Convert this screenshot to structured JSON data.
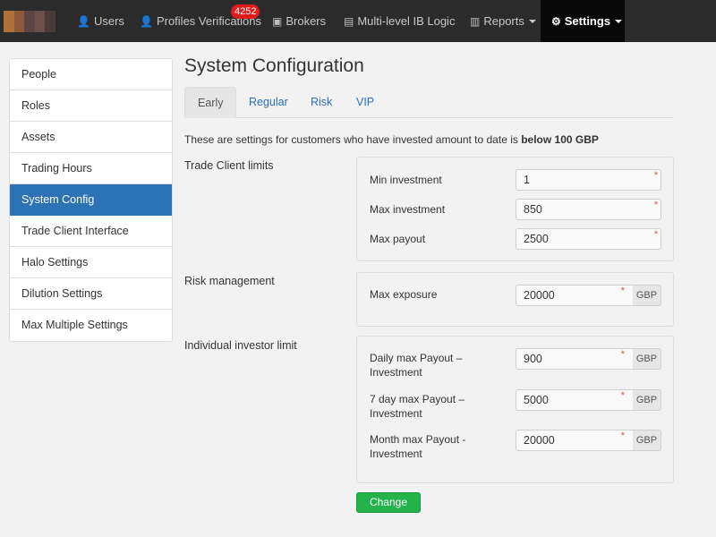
{
  "nav": {
    "items": [
      {
        "label": "Users",
        "icon": "user-icon"
      },
      {
        "label": "Profiles Verifications",
        "icon": "user-icon",
        "badge": "4252"
      },
      {
        "label": "Brokers",
        "icon": "briefcase-icon"
      },
      {
        "label": "Multi-level IB Logic",
        "icon": "org-chart-icon"
      },
      {
        "label": "Reports",
        "icon": "bar-chart-icon"
      },
      {
        "label": "Settings",
        "icon": "gear-icon"
      }
    ]
  },
  "sidebar": {
    "items": [
      {
        "label": "People"
      },
      {
        "label": "Roles"
      },
      {
        "label": "Assets"
      },
      {
        "label": "Trading Hours"
      },
      {
        "label": "System Config"
      },
      {
        "label": "Trade Client Interface"
      },
      {
        "label": "Halo Settings"
      },
      {
        "label": "Dilution Settings"
      },
      {
        "label": "Max Multiple Settings"
      }
    ]
  },
  "main": {
    "title": "System Configuration",
    "tabs": [
      "Early",
      "Regular",
      "Risk",
      "VIP"
    ],
    "description_prefix": "These are settings for customers who have invested amount to date is",
    "description_bold": "below 100 GBP",
    "sections": {
      "trade_client_limits": {
        "label": "Trade Client limits",
        "rows": [
          {
            "label": "Min investment",
            "value": "1"
          },
          {
            "label": "Max investment",
            "value": "850"
          },
          {
            "label": "Max payout",
            "value": "2500"
          }
        ]
      },
      "risk_management": {
        "label": "Risk management",
        "rows": [
          {
            "label": "Max exposure",
            "value": "20000",
            "unit": "GBP"
          }
        ]
      },
      "individual_investor_limit": {
        "label": "Individual investor limit",
        "rows": [
          {
            "label": "Daily max Payout – Investment",
            "value": "900",
            "unit": "GBP"
          },
          {
            "label": "7 day max Payout – Investment",
            "value": "5000",
            "unit": "GBP"
          },
          {
            "label": "Month max Payout - Investment",
            "value": "20000",
            "unit": "GBP"
          }
        ]
      }
    },
    "required_marker": "*",
    "change_button": "Change"
  },
  "colors": {
    "navbar": "#2b2b2b",
    "active_nav": "#080808",
    "badge": "#e01b1b",
    "sidebar_active": "#2d72b5",
    "link": "#2a6ebb",
    "button": "#24b24b"
  }
}
